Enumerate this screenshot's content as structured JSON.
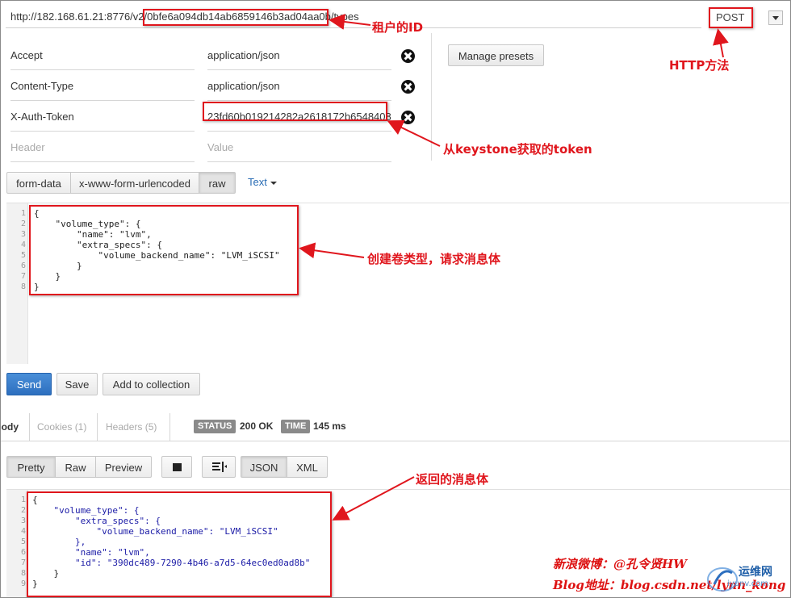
{
  "request": {
    "url": "http://182.168.61.21:8776/v2/0bfe6a094db14ab6859146b3ad04aa0b/types",
    "method": "POST"
  },
  "headers": [
    {
      "key": "Accept",
      "value": "application/json"
    },
    {
      "key": "Content-Type",
      "value": "application/json"
    },
    {
      "key": "X-Auth-Token",
      "value": "23fd60b019214282a2618172b6548408"
    }
  ],
  "header_placeholders": {
    "key": "Header",
    "value": "Value"
  },
  "buttons": {
    "manage_presets": "Manage presets",
    "send": "Send",
    "save": "Save",
    "add_to_collection": "Add to collection"
  },
  "body_modes": [
    "form-data",
    "x-www-form-urlencoded",
    "raw"
  ],
  "body_type": "Text",
  "request_body": {
    "line_numbers": [
      "1",
      "2",
      "3",
      "4",
      "5",
      "6",
      "7",
      "8"
    ],
    "lines": [
      "{",
      "    \"volume_type\": {",
      "        \"name\": \"lvm\",",
      "        \"extra_specs\": {",
      "            \"volume_backend_name\": \"LVM_iSCSI\"",
      "        }",
      "    }",
      "}"
    ]
  },
  "response_tabs": [
    "Body",
    "Cookies (1)",
    "Headers (5)"
  ],
  "status": {
    "label": "STATUS",
    "value": "200 OK"
  },
  "time": {
    "label": "TIME",
    "value": "145 ms"
  },
  "view_modes": [
    "Pretty",
    "Raw",
    "Preview"
  ],
  "format_modes": [
    "JSON",
    "XML"
  ],
  "response_body": {
    "line_numbers": [
      "1",
      "2",
      "3",
      "4",
      "5",
      "6",
      "7",
      "8",
      "9"
    ],
    "lines": [
      "{",
      "    \"volume_type\": {",
      "        \"extra_specs\": {",
      "            \"volume_backend_name\": \"LVM_iSCSI\"",
      "        },",
      "        \"name\": \"lvm\",",
      "        \"id\": \"390dc489-7290-4b46-a7d5-64ec0ed0ad8b\"",
      "    }",
      "}"
    ]
  },
  "annotations": {
    "tenant_id": "租户的ID",
    "http_method": "HTTP方法",
    "token": "从keystone获取的token",
    "request_body": "创建卷类型，请求消息体",
    "response_body": "返回的消息体"
  },
  "watermark": {
    "line1": "新浪微博：@孔令贤HW",
    "line2": "Blog地址：blog.csdn.net/lynn_kong",
    "logo": "运维网",
    "logo_sub": "iyunv.com"
  },
  "colors": {
    "annotation": "#e0161d",
    "send": "#2d6fbf",
    "badge": "#8a8a8a"
  }
}
